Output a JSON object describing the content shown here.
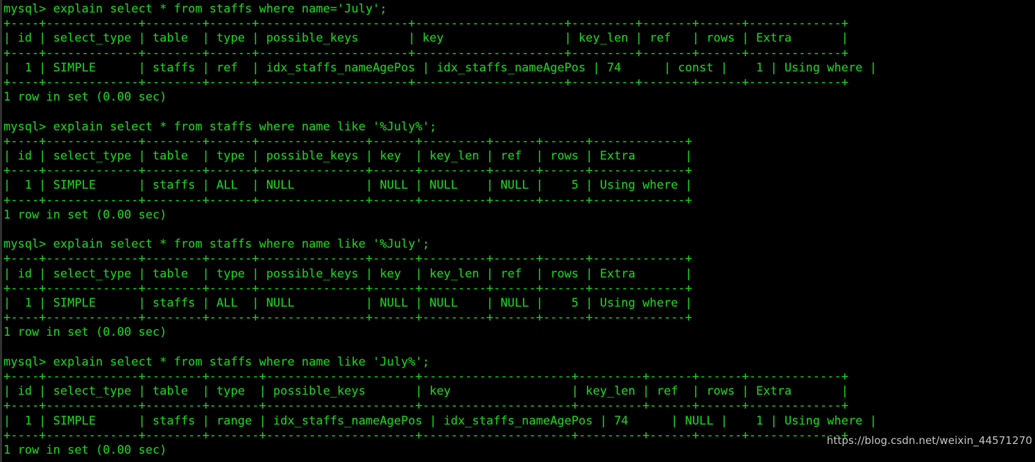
{
  "terminal": {
    "prompt": "mysql> ",
    "colors": {
      "background": "#000000",
      "foreground": "#1ad01a",
      "watermark": "#d8d8d8",
      "left_edge": "#3a3a3a"
    },
    "watermark": "https://blog.csdn.net/weixin_44571270",
    "result_footer": "1 row in set (0.00 sec)"
  },
  "blocks": [
    {
      "id": "block-1",
      "command": "mysql> explain select * from staffs where name='July';",
      "separator": "+----+-------------+--------+------+---------------------+---------------------+---------+-------+------+-------------+",
      "header": "| id | select_type | table  | type | possible_keys       | key                 | key_len | ref   | rows | Extra       |",
      "row": "|  1 | SIMPLE      | staffs | ref  | idx_staffs_nameAgePos | idx_staffs_nameAgePos | 74      | const |    1 | Using where |",
      "footer": "1 row in set (0.00 sec)",
      "explain": {
        "id": "1",
        "select_type": "SIMPLE",
        "table": "staffs",
        "type": "ref",
        "possible_keys": "idx_staffs_nameAgePos",
        "key": "idx_staffs_nameAgePos",
        "key_len": "74",
        "ref": "const",
        "rows": "1",
        "extra": "Using where"
      }
    },
    {
      "id": "block-2",
      "command": "mysql> explain select * from staffs where name like '%July%';",
      "separator": "+----+-------------+--------+------+---------------+------+---------+------+------+-------------+",
      "header": "| id | select_type | table  | type | possible_keys | key  | key_len | ref  | rows | Extra       |",
      "row": "|  1 | SIMPLE      | staffs | ALL  | NULL          | NULL | NULL    | NULL |    5 | Using where |",
      "footer": "1 row in set (0.00 sec)",
      "explain": {
        "id": "1",
        "select_type": "SIMPLE",
        "table": "staffs",
        "type": "ALL",
        "possible_keys": "NULL",
        "key": "NULL",
        "key_len": "NULL",
        "ref": "NULL",
        "rows": "5",
        "extra": "Using where"
      }
    },
    {
      "id": "block-3",
      "command": "mysql> explain select * from staffs where name like '%July';",
      "separator": "+----+-------------+--------+------+---------------+------+---------+------+------+-------------+",
      "header": "| id | select_type | table  | type | possible_keys | key  | key_len | ref  | rows | Extra       |",
      "row": "|  1 | SIMPLE      | staffs | ALL  | NULL          | NULL | NULL    | NULL |    5 | Using where |",
      "footer": "1 row in set (0.00 sec)",
      "explain": {
        "id": "1",
        "select_type": "SIMPLE",
        "table": "staffs",
        "type": "ALL",
        "possible_keys": "NULL",
        "key": "NULL",
        "key_len": "NULL",
        "ref": "NULL",
        "rows": "5",
        "extra": "Using where"
      }
    },
    {
      "id": "block-4",
      "command": "mysql> explain select * from staffs where name like 'July%';",
      "separator": "+----+-------------+--------+-------+---------------------+---------------------+---------+------+------+-------------+",
      "header": "| id | select_type | table  | type  | possible_keys       | key                 | key_len | ref  | rows | Extra       |",
      "row": "|  1 | SIMPLE      | staffs | range | idx_staffs_nameAgePos | idx_staffs_nameAgePos | 74      | NULL |    1 | Using where |",
      "footer": "1 row in set (0.00 sec)",
      "explain": {
        "id": "1",
        "select_type": "SIMPLE",
        "table": "staffs",
        "type": "range",
        "possible_keys": "idx_staffs_nameAgePos",
        "key": "idx_staffs_nameAgePos",
        "key_len": "74",
        "ref": "NULL",
        "rows": "1",
        "extra": "Using where"
      }
    }
  ]
}
